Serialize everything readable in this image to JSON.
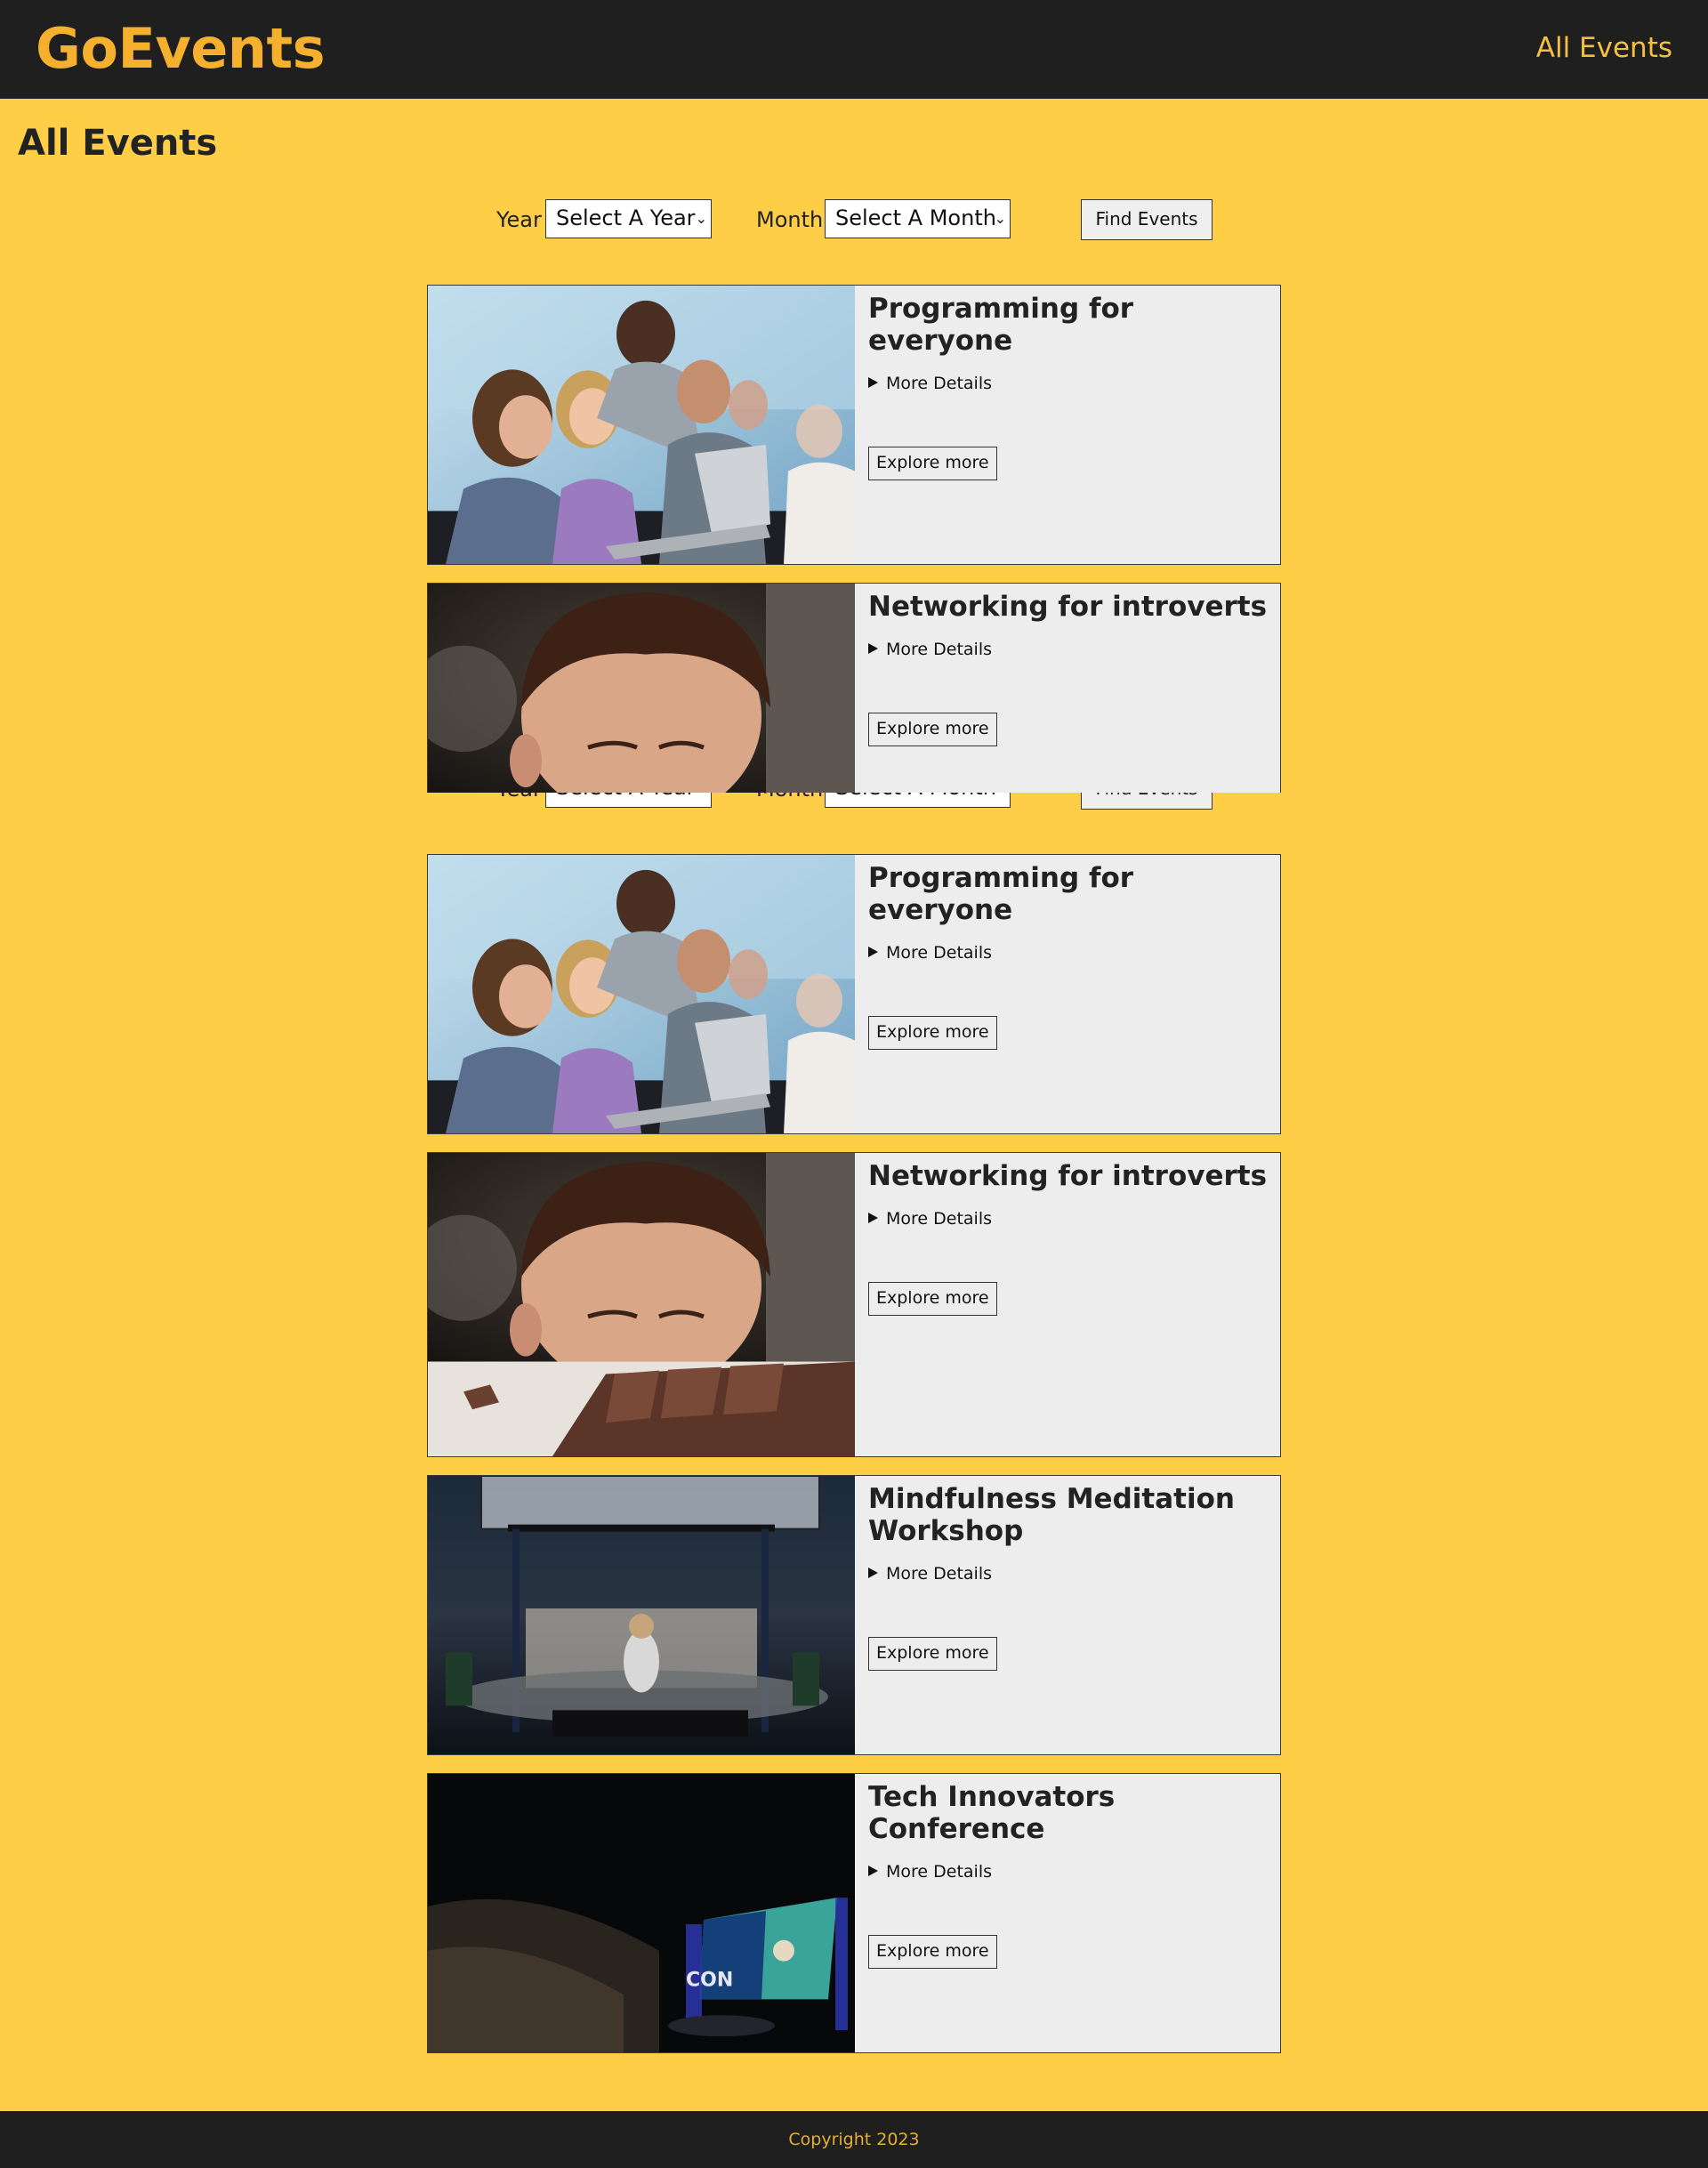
{
  "header": {
    "logo": "GoEvents",
    "nav_all_events": "All Events"
  },
  "page_title": "All Events",
  "filters": {
    "year_label": "Year",
    "year_value": "Select A Year",
    "month_label": "Month",
    "month_value": "Select A Month",
    "find_button": "Find Events"
  },
  "events": [
    {
      "title": "Programming for everyone",
      "details_label": "More Details",
      "button": "Explore more",
      "image": "group-laptop-photo"
    },
    {
      "title": "Networking for introverts",
      "details_label": "More Details",
      "button": "Explore more",
      "image": "boy-looking-down-photo"
    },
    {
      "title": "Programming for everyone",
      "details_label": "More Details",
      "button": "Explore more",
      "image": "group-laptop-photo"
    },
    {
      "title": "Networking for introverts",
      "details_label": "More Details",
      "button": "Explore more",
      "image": "boy-and-chocolate-photo"
    },
    {
      "title": "Mindfulness Meditation Workshop",
      "details_label": "More Details",
      "button": "Explore more",
      "image": "meditation-hall-photo"
    },
    {
      "title": "Tech Innovators Conference",
      "details_label": "More Details",
      "button": "Explore more",
      "image": "conference-auditorium-photo"
    }
  ],
  "footer": {
    "copyright": "Copyright 2023"
  }
}
